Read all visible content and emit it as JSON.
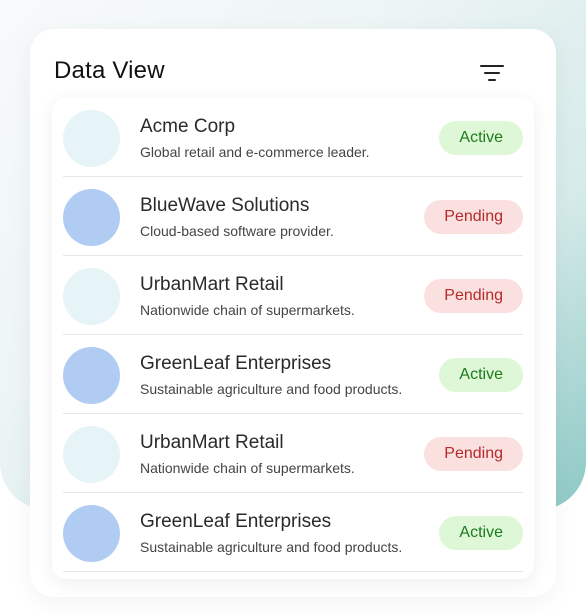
{
  "title": "Data View",
  "filter_icon": "filter-icon",
  "colors": {
    "active_bg": "#ddf7d7",
    "active_text": "#1d7a1d",
    "pending_bg": "#fbe0e0",
    "pending_text": "#b52a2a",
    "avatar_light": "#e6f4f7",
    "avatar_blue": "#b0ccf2"
  },
  "items": [
    {
      "name": "Acme Corp",
      "description": "Global retail and e-commerce leader.",
      "status": "Active",
      "avatar": "light"
    },
    {
      "name": "BlueWave Solutions",
      "description": "Cloud-based software provider.",
      "status": "Pending",
      "avatar": "blue"
    },
    {
      "name": "UrbanMart Retail",
      "description": "Nationwide chain of supermarkets.",
      "status": "Pending",
      "avatar": "light"
    },
    {
      "name": "GreenLeaf Enterprises",
      "description": "Sustainable agriculture and food products.",
      "status": "Active",
      "avatar": "blue"
    },
    {
      "name": "UrbanMart Retail",
      "description": "Nationwide chain of supermarkets.",
      "status": "Pending",
      "avatar": "light"
    },
    {
      "name": "GreenLeaf Enterprises",
      "description": "Sustainable agriculture and food products.",
      "status": "Active",
      "avatar": "blue"
    }
  ]
}
